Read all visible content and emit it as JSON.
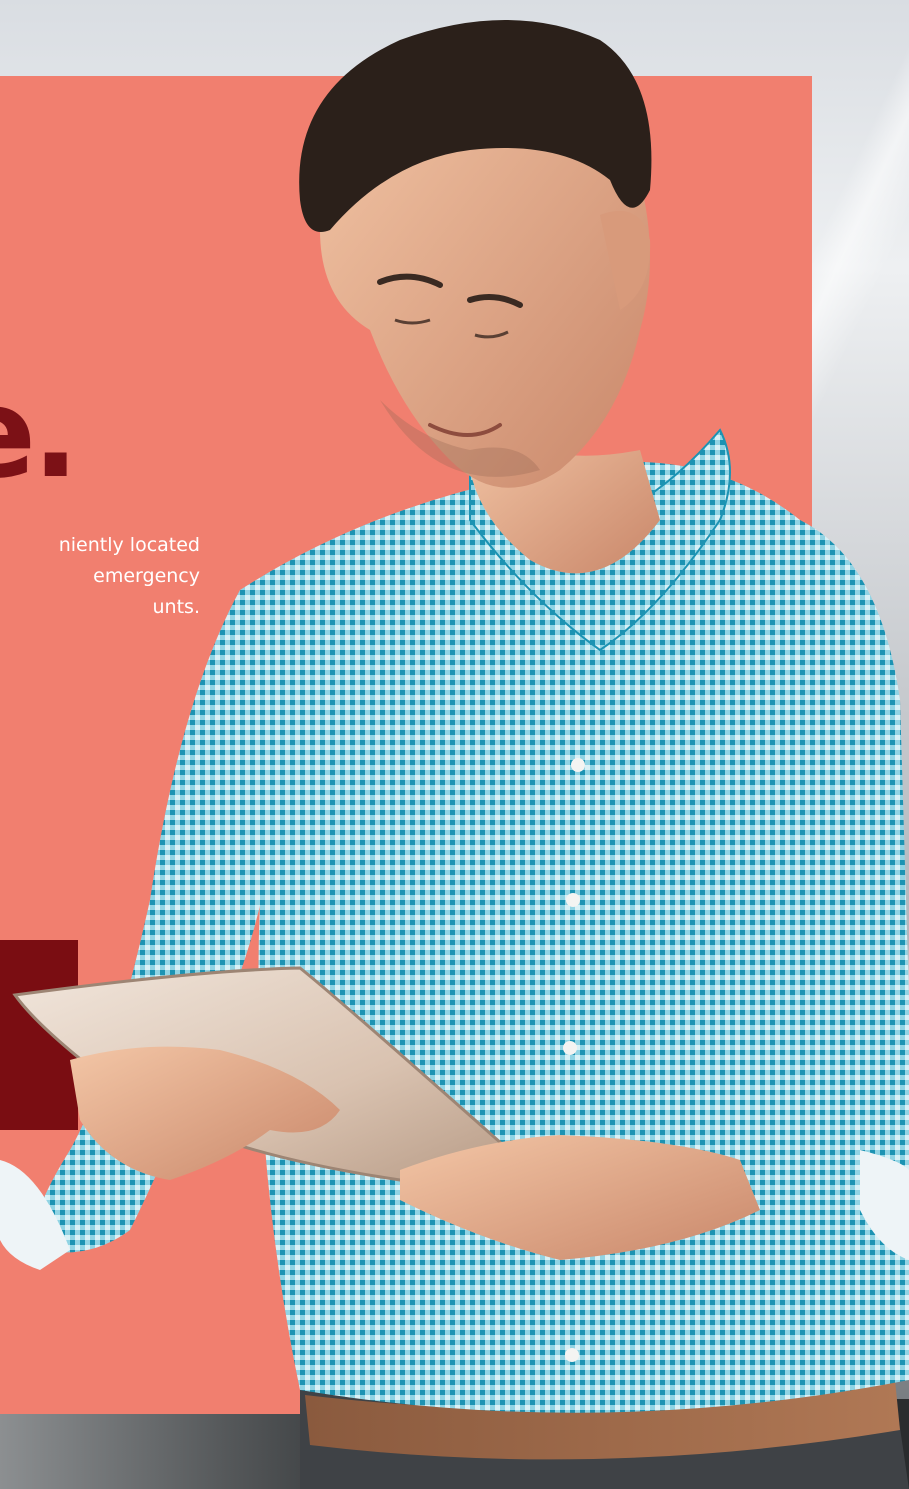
{
  "hero": {
    "headline_fragment": "e.",
    "body_lines": [
      "niently located",
      "emergency",
      "unts."
    ]
  },
  "colors": {
    "panel": "#f17f6f",
    "headline": "#7c1116",
    "cta_block": "#7a0d12",
    "shirt": "#3fb0c9",
    "text": "#ffffff"
  },
  "icons": {
    "person": "man-holding-tablet-photo"
  }
}
